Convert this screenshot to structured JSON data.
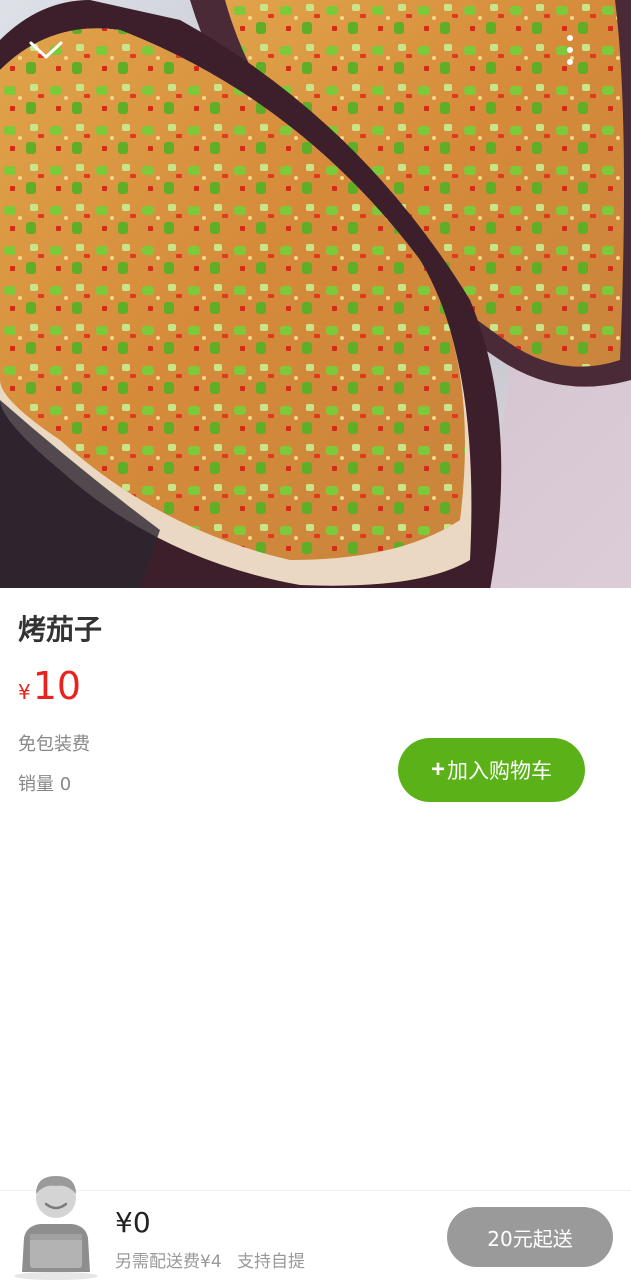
{
  "product": {
    "name": "烤茄子",
    "currency_symbol": "¥",
    "price": "10",
    "packing_fee_note": "免包装费",
    "sales_label": "销量 0"
  },
  "actions": {
    "add_to_cart_plus": "+",
    "add_to_cart_label": "加入购物车"
  },
  "cart": {
    "total": "¥0",
    "delivery_fee_note": "另需配送费¥4",
    "pickup_note": "支持自提",
    "min_order_label": "20元起送"
  },
  "icons": {
    "collapse": "chevron-down-icon",
    "more": "more-vertical-icon"
  },
  "colors": {
    "price": "#e8231d",
    "add_to_cart": "#5bb118",
    "min_order_disabled": "#9a9a9a"
  }
}
